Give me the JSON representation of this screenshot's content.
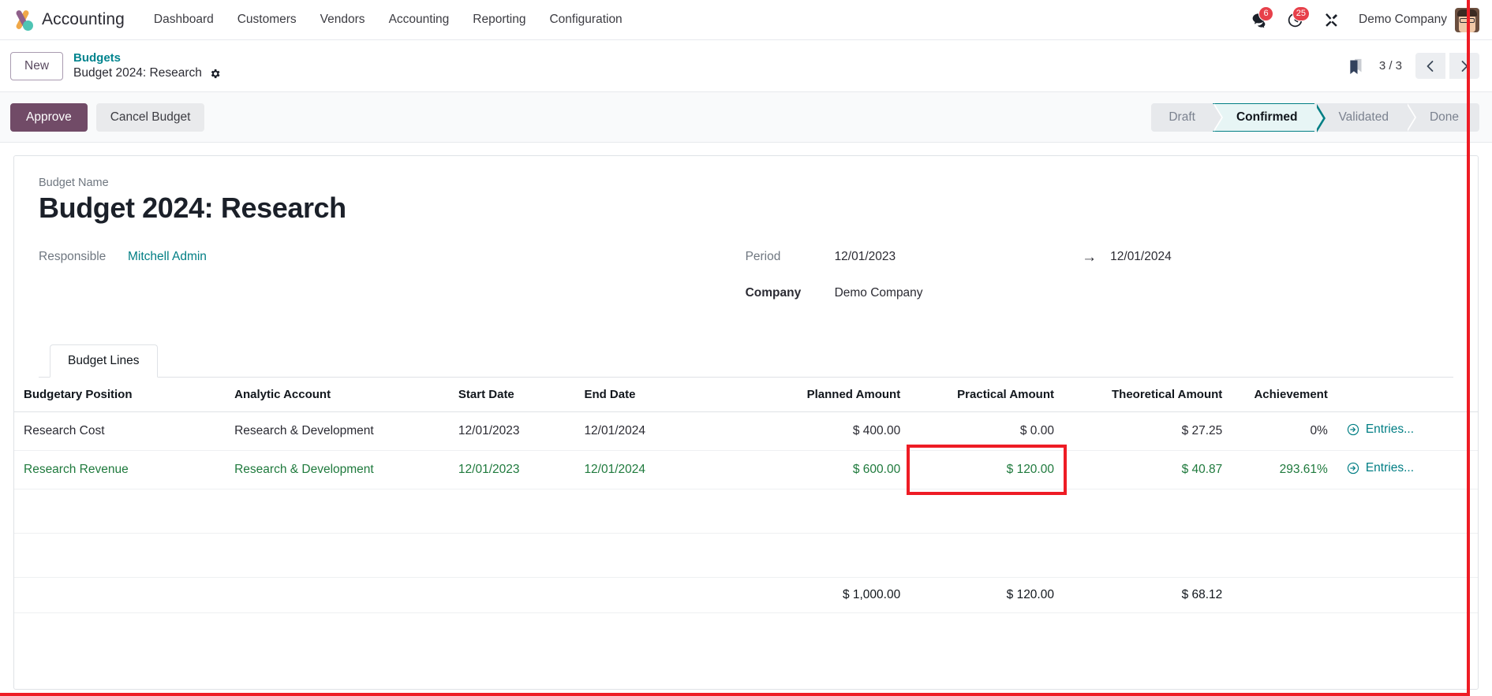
{
  "navbar": {
    "brand": "Accounting",
    "menu": [
      {
        "label": "Dashboard"
      },
      {
        "label": "Customers"
      },
      {
        "label": "Vendors"
      },
      {
        "label": "Accounting"
      },
      {
        "label": "Reporting"
      },
      {
        "label": "Configuration"
      }
    ],
    "messages_badge": "6",
    "activities_badge": "25",
    "company": "Demo Company"
  },
  "control_panel": {
    "new_label": "New",
    "breadcrumb_parent": "Budgets",
    "breadcrumb_current": "Budget 2024: Research",
    "pager": "3 / 3"
  },
  "statusbar": {
    "approve_label": "Approve",
    "cancel_label": "Cancel Budget",
    "steps": [
      {
        "label": "Draft",
        "active": false
      },
      {
        "label": "Confirmed",
        "active": true
      },
      {
        "label": "Validated",
        "active": false
      },
      {
        "label": "Done",
        "active": false
      }
    ]
  },
  "form": {
    "budget_name_label": "Budget Name",
    "budget_name_value": "Budget 2024: Research",
    "responsible_label": "Responsible",
    "responsible_value": "Mitchell Admin",
    "period_label": "Period",
    "period_from": "12/01/2023",
    "period_arrow": "→",
    "period_to": "12/01/2024",
    "company_label": "Company",
    "company_value": "Demo Company"
  },
  "notebook": {
    "tabs": [
      {
        "label": "Budget Lines",
        "active": true
      }
    ]
  },
  "table": {
    "headers": [
      "Budgetary Position",
      "Analytic Account",
      "Start Date",
      "End Date",
      "Planned Amount",
      "Practical Amount",
      "Theoretical Amount",
      "Achievement",
      ""
    ],
    "rows": [
      {
        "position": "Research Cost",
        "analytic_account": "Research & Development",
        "start_date": "12/01/2023",
        "end_date": "12/01/2024",
        "planned": "$ 400.00",
        "practical": "$ 0.00",
        "theoretical": "$ 27.25",
        "achievement": "0%",
        "entries": "Entries...",
        "selected": false,
        "practical_highlighted": false,
        "entries_highlighted": false
      },
      {
        "position": "Research Revenue",
        "analytic_account": "Research & Development",
        "start_date": "12/01/2023",
        "end_date": "12/01/2024",
        "planned": "$ 600.00",
        "practical": "$ 120.00",
        "theoretical": "$ 40.87",
        "achievement": "293.61%",
        "entries": "Entries...",
        "selected": true,
        "practical_highlighted": true,
        "entries_highlighted": true
      }
    ],
    "totals": {
      "planned": "$ 1,000.00",
      "practical": "$ 120.00",
      "theoretical": "$ 68.12"
    }
  },
  "colors": {
    "brand_primary": "#714b67",
    "accent_teal": "#017e84",
    "badge_red": "#e7404a",
    "highlight_red": "#ee1c25",
    "selected_row_green": "#1f7a3d"
  }
}
